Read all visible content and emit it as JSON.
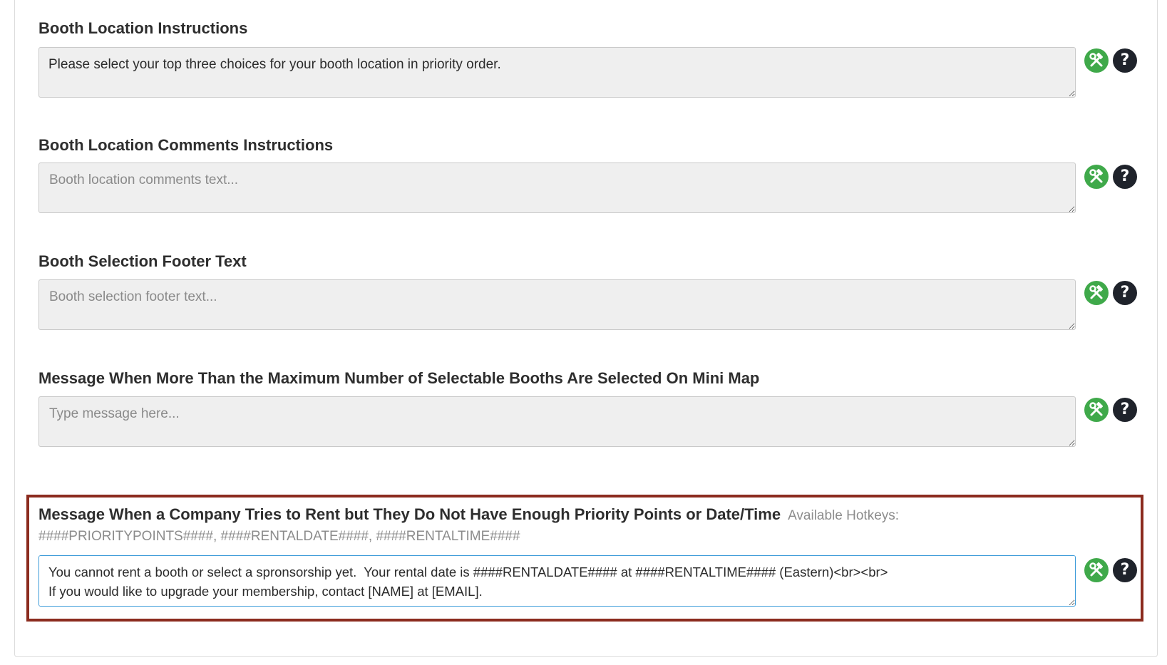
{
  "fields": [
    {
      "label": "Booth Location Instructions",
      "value": "Please select your top three choices for your booth location in priority order.",
      "placeholder": ""
    },
    {
      "label": "Booth Location Comments Instructions",
      "value": "",
      "placeholder": "Booth location comments text..."
    },
    {
      "label": "Booth Selection Footer Text",
      "value": "",
      "placeholder": "Booth selection footer text..."
    },
    {
      "label": "Message When More Than the Maximum Number of Selectable Booths Are Selected On Mini Map",
      "value": "",
      "placeholder": "Type message here..."
    },
    {
      "label": "Message When a Company Tries to Rent but They Do Not Have Enough Priority Points or Date/Time",
      "hotkeys_label": "Available Hotkeys:",
      "hotkeys": "####PRIORITYPOINTS####, ####RENTALDATE####, ####RENTALTIME####",
      "value": "You cannot rent a booth or select a spronsorship yet.  Your rental date is ####RENTALDATE#### at ####RENTALTIME#### (Eastern)<br><br>\nIf you would like to upgrade your membership, contact [NAME] at [EMAIL].",
      "placeholder": ""
    }
  ],
  "icons": {
    "tools": "hammer-wrench-icon",
    "help": "question-mark-icon",
    "help_glyph": "?"
  },
  "colors": {
    "tools_green": "#3fa94a",
    "help_dark": "#1f232b",
    "highlight_border": "#8b2b1e",
    "active_input_border": "#3c9bd9"
  }
}
